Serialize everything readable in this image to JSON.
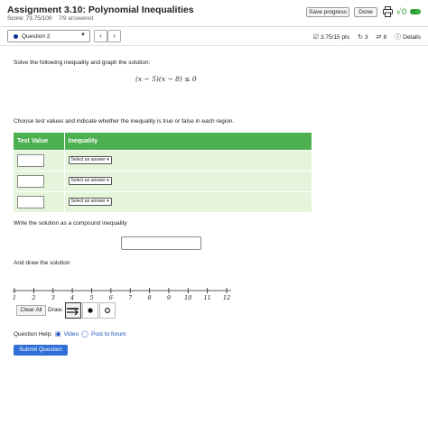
{
  "header": {
    "title": "Assignment 3.10: Polynomial Inequalities",
    "score": "Score: 73.75/100",
    "answered": "7/9 answered",
    "save_label": "Save progress",
    "done_label": "Done",
    "math_icon_label": "√0"
  },
  "question_bar": {
    "selected_question": "Question 2",
    "prev_label": "‹",
    "next_label": "›",
    "points": "3.75/15 pts",
    "retries": "3",
    "attempts": "8",
    "details_label": "Details"
  },
  "question": {
    "prompt": "Solve the following inequality and graph the solution:",
    "inequality": "(x − 5)(x − 8) ≤ 0",
    "test_prompt": "Choose test values and indicate whether the inequality is true or false in each region.",
    "table_headers": [
      "Test Value",
      "Inequality"
    ],
    "rows": [
      {
        "value": "",
        "answer": "Select an answer"
      },
      {
        "value": "",
        "answer": "Select an answer"
      },
      {
        "value": "",
        "answer": "Select an answer"
      }
    ],
    "compound_prompt": "Write the solution as a compound inequality",
    "compound_value": "",
    "draw_prompt": "And draw the solution"
  },
  "number_line": {
    "ticks": [
      "1",
      "2",
      "3",
      "4",
      "5",
      "6",
      "7",
      "8",
      "9",
      "10",
      "11",
      "12"
    ]
  },
  "draw_tools": {
    "clear_label": "Clear All",
    "draw_label": "Draw:"
  },
  "help": {
    "label": "Question Help:",
    "video_label": "Video",
    "forum_label": "Post to forum"
  },
  "submit_label": "Submit Question",
  "colors": {
    "table_header": "#4caf50",
    "table_row": "#e5f5dc",
    "submit": "#2f6fd6",
    "link": "#1c4fbf",
    "question_dot": "#0b2f8a"
  }
}
